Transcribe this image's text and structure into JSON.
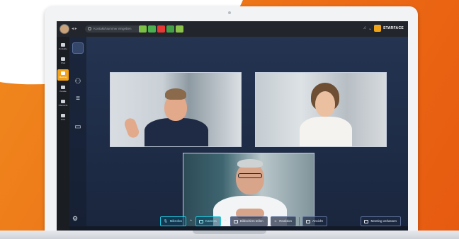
{
  "titlebar": {
    "search_placeholder": "Kontakt/Nummer eingeben",
    "brand": "STARFACE",
    "apps": [
      "#7bbf45",
      "#4caf50",
      "#e53935",
      "#43a047",
      "#8bc34a"
    ]
  },
  "rail": {
    "items": [
      {
        "label": "Kontakte",
        "icon": "contacts-icon"
      },
      {
        "label": "Chat",
        "icon": "chat-icon"
      },
      {
        "label": "Meeting",
        "icon": "meeting-icon",
        "active": true
      },
      {
        "label": "Kanäle",
        "icon": "channels-icon"
      },
      {
        "label": "Übersicht",
        "icon": "overview-icon"
      },
      {
        "label": "Liste",
        "icon": "list-icon"
      }
    ]
  },
  "controls": {
    "mic": "Mikrofon",
    "camera": "Kamera",
    "share": "Bildschirm teilen",
    "reaction": "Reaktion",
    "view": "Ansicht",
    "leave": "Meeting verlassen"
  },
  "colors": {
    "accent": "#f3a21b",
    "active_control": "#1ec7e0",
    "meeting_bg": "#243451",
    "orange_bg": "#ec6a14"
  }
}
